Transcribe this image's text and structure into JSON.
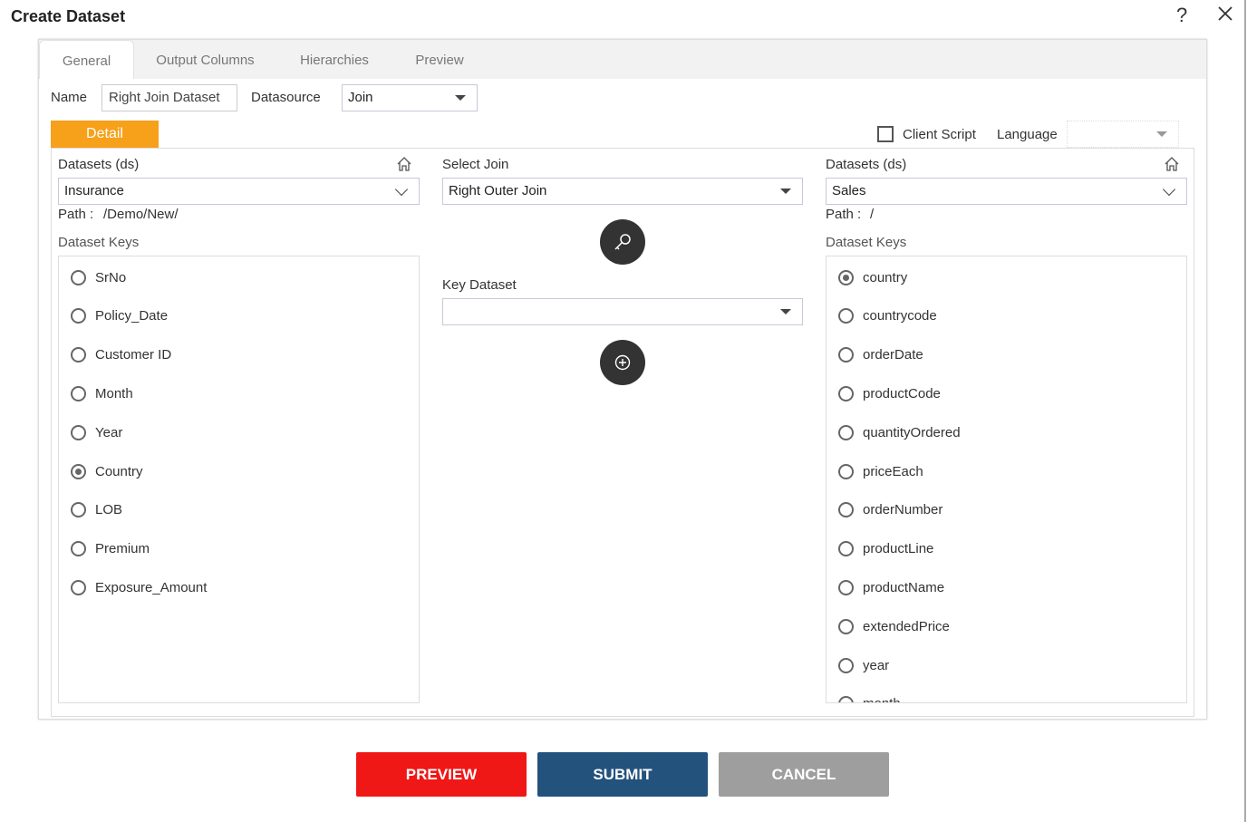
{
  "dialog": {
    "title": "Create Dataset",
    "help_icon": "question-icon",
    "close_icon": "close-icon"
  },
  "tabs": [
    {
      "label": "General",
      "active": true
    },
    {
      "label": "Output Columns"
    },
    {
      "label": "Hierarchies"
    },
    {
      "label": "Preview"
    }
  ],
  "general": {
    "name_label": "Name",
    "name_value": "Right Join Dataset",
    "datasource_label": "Datasource",
    "datasource_value": "Join"
  },
  "detail_tab": "Detail",
  "client_script": {
    "label": "Client Script",
    "checked": false
  },
  "language": {
    "label": "Language",
    "value": ""
  },
  "left": {
    "datasets_label": "Datasets (ds)",
    "dataset_value": "Insurance",
    "path_label": "Path :",
    "path_value": "/Demo/New/",
    "keys_label": "Dataset Keys",
    "keys": [
      "SrNo",
      "Policy_Date",
      "Customer ID",
      "Month",
      "Year",
      "Country",
      "LOB",
      "Premium",
      "Exposure_Amount"
    ],
    "selected": "Country"
  },
  "middle": {
    "select_join_label": "Select Join",
    "select_join_value": "Right Outer Join",
    "key_dataset_label": "Key Dataset",
    "key_dataset_value": ""
  },
  "right": {
    "datasets_label": "Datasets (ds)",
    "dataset_value": "Sales",
    "path_label": "Path :",
    "path_value": "/",
    "keys_label": "Dataset Keys",
    "keys": [
      "country",
      "countrycode",
      "orderDate",
      "productCode",
      "quantityOrdered",
      "priceEach",
      "orderNumber",
      "productLine",
      "productName",
      "extendedPrice",
      "year",
      "month"
    ],
    "selected": "country"
  },
  "buttons": {
    "preview": "PREVIEW",
    "submit": "SUBMIT",
    "cancel": "CANCEL"
  },
  "colors": {
    "detail": "#f7a01a",
    "preview": "#f01717",
    "submit": "#23527c",
    "cancel": "#9e9e9e"
  }
}
